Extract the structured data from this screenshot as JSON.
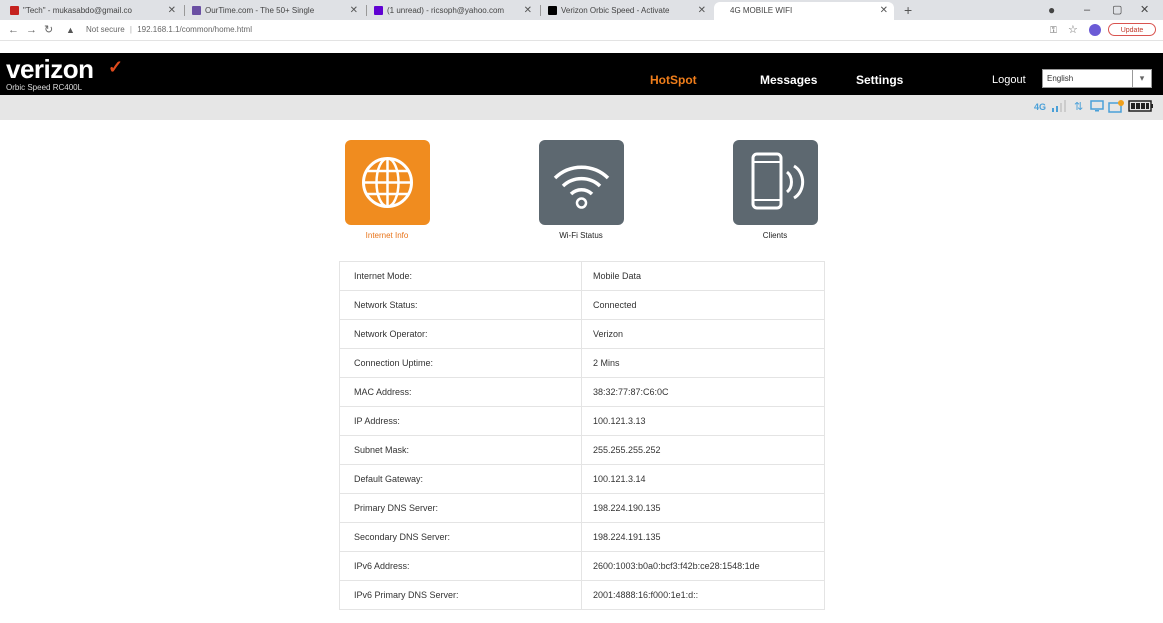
{
  "browser": {
    "tabs": [
      {
        "title": "\"Tech\" - mukasabdo@gmail.co",
        "favicon_color": "#c5221f"
      },
      {
        "title": "OurTime.com - The 50+ Single",
        "favicon_color": "#6a4fa3"
      },
      {
        "title": "(1 unread) - ricsoph@yahoo.com",
        "favicon_color": "#6001d2"
      },
      {
        "title": "Verizon Orbic Speed - Activate",
        "favicon_color": "#000000"
      },
      {
        "title": "4G MOBILE WIFI",
        "favicon_color": "#ffffff"
      }
    ],
    "url_warning": "Not secure",
    "url": "192.168.1.1/common/home.html",
    "update_label": "Update"
  },
  "header": {
    "logo": "verizon",
    "logo_sub": "Orbic Speed RC400L",
    "nav": [
      {
        "label": "HotSpot",
        "active": true
      },
      {
        "label": "Messages",
        "active": false
      },
      {
        "label": "Settings",
        "active": false
      }
    ],
    "logout": "Logout",
    "language": "English"
  },
  "status_icons": [
    "4G",
    "signal",
    "data-transfer",
    "devices",
    "messages",
    "battery"
  ],
  "sections": [
    {
      "label": "Internet Info",
      "icon": "globe-icon",
      "active": true
    },
    {
      "label": "Wi-Fi Status",
      "icon": "wifi-icon",
      "active": false
    },
    {
      "label": "Clients",
      "icon": "phone-icon",
      "active": false
    }
  ],
  "info_rows": [
    {
      "label": "Internet Mode:",
      "value": "Mobile Data"
    },
    {
      "label": "Network Status:",
      "value": "Connected"
    },
    {
      "label": "Network Operator:",
      "value": "Verizon"
    },
    {
      "label": "Connection Uptime:",
      "value": "2 Mins"
    },
    {
      "label": "MAC Address:",
      "value": "38:32:77:87:C6:0C"
    },
    {
      "label": "IP Address:",
      "value": "100.121.3.13"
    },
    {
      "label": "Subnet Mask:",
      "value": "255.255.255.252"
    },
    {
      "label": "Default Gateway:",
      "value": "100.121.3.14"
    },
    {
      "label": "Primary DNS Server:",
      "value": "198.224.190.135"
    },
    {
      "label": "Secondary DNS Server:",
      "value": "198.224.191.135"
    },
    {
      "label": "IPv6 Address:",
      "value": "2600:1003:b0a0:bcf3:f42b:ce28:1548:1de"
    },
    {
      "label": "IPv6 Primary DNS Server:",
      "value": "2001:4888:16:f000:1e1:d::"
    }
  ],
  "colors": {
    "accent": "#f08c1f",
    "header_bg": "#000000",
    "icon_bg": "#5d6870"
  }
}
